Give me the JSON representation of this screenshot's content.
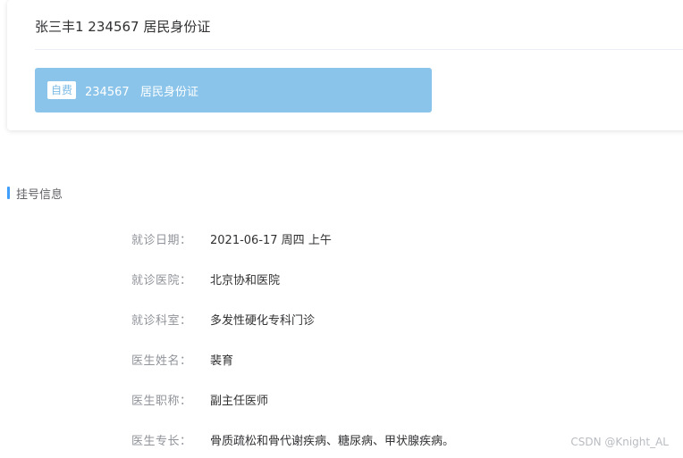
{
  "patient": {
    "title": "张三丰1 234567 居民身份证",
    "pay_type_badge": "自费",
    "id_line": "234567   居民身份证"
  },
  "registration": {
    "section_title": "挂号信息",
    "rows": [
      {
        "label": "就诊日期：",
        "value": "2021-06-17 周四 上午"
      },
      {
        "label": "就诊医院：",
        "value": "北京协和医院"
      },
      {
        "label": "就诊科室：",
        "value": "多发性硬化专科门诊"
      },
      {
        "label": "医生姓名：",
        "value": "裴育"
      },
      {
        "label": "医生职称：",
        "value": "副主任医师"
      },
      {
        "label": "医生专长：",
        "value": "骨质疏松和骨代谢疾病、糖尿病、甲状腺疾病。"
      }
    ]
  },
  "watermark": "CSDN @Knight_AL",
  "colors": {
    "patient_bar": "#8ac4ea",
    "section_marker": "#409eff"
  }
}
